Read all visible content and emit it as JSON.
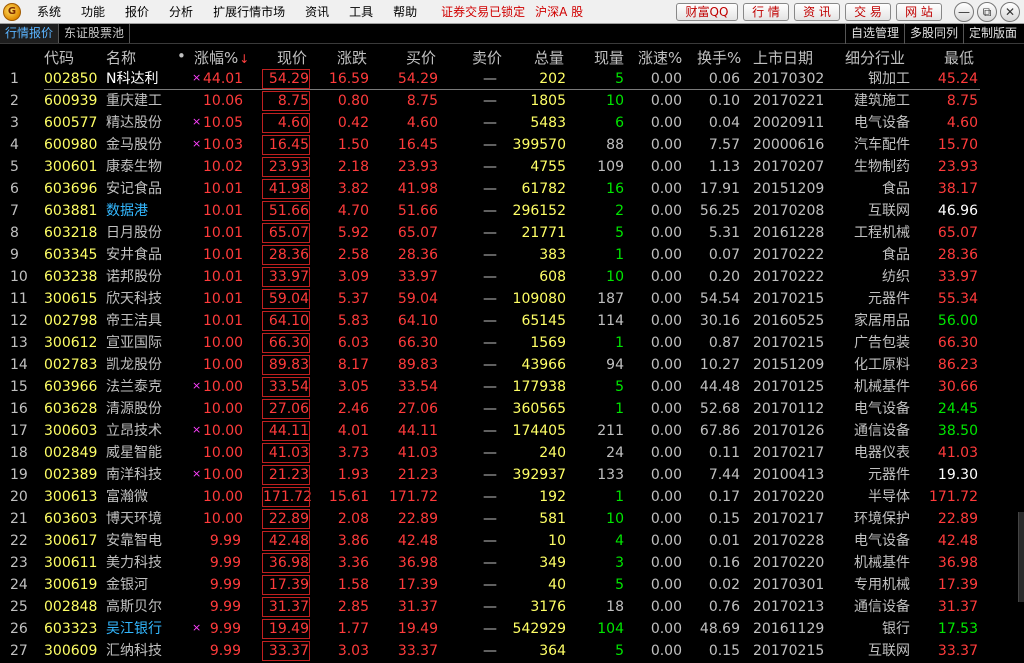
{
  "menu": {
    "items": [
      "系统",
      "功能",
      "报价",
      "分析",
      "扩展行情市场",
      "资讯",
      "工具",
      "帮助"
    ],
    "status": "证券交易已锁定",
    "market": "沪深A 股"
  },
  "top_buttons": [
    "财富QQ",
    "行 情",
    "资 讯",
    "交 易",
    "网 站"
  ],
  "window_controls": [
    "—",
    "⧉",
    "✕"
  ],
  "tabs": {
    "active": "行情报价",
    "other": "东证股票池"
  },
  "right_tabs": [
    "自选管理",
    "多股同列",
    "定制版面"
  ],
  "columns": {
    "code": "代码",
    "name": "名称",
    "dot": "•",
    "pct": "涨幅%",
    "sort": "↓",
    "price": "现价",
    "chg": "涨跌",
    "bid": "买价",
    "ask": "卖价",
    "vol": "总量",
    "cur": "现量",
    "speed": "涨速%",
    "turn": "换手%",
    "date": "上市日期",
    "ind": "细分行业",
    "low": "最低"
  },
  "rows": [
    {
      "idx": "1",
      "code": "002850",
      "name": "N科达利",
      "mark": "×",
      "pct": "44.01",
      "price": "54.29",
      "chg": "16.59",
      "bid": "54.29",
      "ask": "—",
      "vol": "202",
      "cur": "5",
      "speed": "0.00",
      "turn": "0.06",
      "date": "20170302",
      "ind": "钢加工",
      "low": "45.24",
      "name_style": "bold",
      "cur_style": "green",
      "low_style": "red"
    },
    {
      "idx": "2",
      "code": "600939",
      "name": "重庆建工",
      "mark": "",
      "pct": "10.06",
      "price": "8.75",
      "chg": "0.80",
      "bid": "8.75",
      "ask": "—",
      "vol": "1805",
      "cur": "10",
      "speed": "0.00",
      "turn": "0.10",
      "date": "20170221",
      "ind": "建筑施工",
      "low": "8.75",
      "name_style": "",
      "cur_style": "green",
      "low_style": "red"
    },
    {
      "idx": "3",
      "code": "600577",
      "name": "精达股份",
      "mark": "×",
      "pct": "10.05",
      "price": "4.60",
      "chg": "0.42",
      "bid": "4.60",
      "ask": "—",
      "vol": "5483",
      "cur": "6",
      "speed": "0.00",
      "turn": "0.04",
      "date": "20020911",
      "ind": "电气设备",
      "low": "4.60",
      "name_style": "",
      "cur_style": "green",
      "low_style": "red"
    },
    {
      "idx": "4",
      "code": "600980",
      "name": "金马股份",
      "mark": "×",
      "pct": "10.03",
      "price": "16.45",
      "chg": "1.50",
      "bid": "16.45",
      "ask": "—",
      "vol": "399570",
      "cur": "88",
      "speed": "0.00",
      "turn": "7.57",
      "date": "20000616",
      "ind": "汽车配件",
      "low": "15.70",
      "name_style": "",
      "cur_style": "",
      "low_style": "red"
    },
    {
      "idx": "5",
      "code": "300601",
      "name": "康泰生物",
      "mark": "",
      "pct": "10.02",
      "price": "23.93",
      "chg": "2.18",
      "bid": "23.93",
      "ask": "—",
      "vol": "4755",
      "cur": "109",
      "speed": "0.00",
      "turn": "1.13",
      "date": "20170207",
      "ind": "生物制药",
      "low": "23.93",
      "name_style": "",
      "cur_style": "",
      "low_style": "red"
    },
    {
      "idx": "6",
      "code": "603696",
      "name": "安记食品",
      "mark": "",
      "pct": "10.01",
      "price": "41.98",
      "chg": "3.82",
      "bid": "41.98",
      "ask": "—",
      "vol": "61782",
      "cur": "16",
      "speed": "0.00",
      "turn": "17.91",
      "date": "20151209",
      "ind": "食品",
      "low": "38.17",
      "name_style": "",
      "cur_style": "green",
      "low_style": "red"
    },
    {
      "idx": "7",
      "code": "603881",
      "name": "数据港",
      "mark": "",
      "pct": "10.01",
      "price": "51.66",
      "chg": "4.70",
      "bid": "51.66",
      "ask": "—",
      "vol": "296152",
      "cur": "2",
      "speed": "0.00",
      "turn": "56.25",
      "date": "20170208",
      "ind": "互联网",
      "low": "46.96",
      "name_style": "hl",
      "cur_style": "green",
      "low_style": "white"
    },
    {
      "idx": "8",
      "code": "603218",
      "name": "日月股份",
      "mark": "",
      "pct": "10.01",
      "price": "65.07",
      "chg": "5.92",
      "bid": "65.07",
      "ask": "—",
      "vol": "21771",
      "cur": "5",
      "speed": "0.00",
      "turn": "5.31",
      "date": "20161228",
      "ind": "工程机械",
      "low": "65.07",
      "name_style": "",
      "cur_style": "green",
      "low_style": "red"
    },
    {
      "idx": "9",
      "code": "603345",
      "name": "安井食品",
      "mark": "",
      "pct": "10.01",
      "price": "28.36",
      "chg": "2.58",
      "bid": "28.36",
      "ask": "—",
      "vol": "383",
      "cur": "1",
      "speed": "0.00",
      "turn": "0.07",
      "date": "20170222",
      "ind": "食品",
      "low": "28.36",
      "name_style": "",
      "cur_style": "green",
      "low_style": "red"
    },
    {
      "idx": "10",
      "code": "603238",
      "name": "诺邦股份",
      "mark": "",
      "pct": "10.01",
      "price": "33.97",
      "chg": "3.09",
      "bid": "33.97",
      "ask": "—",
      "vol": "608",
      "cur": "10",
      "speed": "0.00",
      "turn": "0.20",
      "date": "20170222",
      "ind": "纺织",
      "low": "33.97",
      "name_style": "",
      "cur_style": "green",
      "low_style": "red"
    },
    {
      "idx": "11",
      "code": "300615",
      "name": "欣天科技",
      "mark": "",
      "pct": "10.01",
      "price": "59.04",
      "chg": "5.37",
      "bid": "59.04",
      "ask": "—",
      "vol": "109080",
      "cur": "187",
      "speed": "0.00",
      "turn": "54.54",
      "date": "20170215",
      "ind": "元器件",
      "low": "55.34",
      "name_style": "",
      "cur_style": "",
      "low_style": "red"
    },
    {
      "idx": "12",
      "code": "002798",
      "name": "帝王洁具",
      "mark": "",
      "pct": "10.01",
      "price": "64.10",
      "chg": "5.83",
      "bid": "64.10",
      "ask": "—",
      "vol": "65145",
      "cur": "114",
      "speed": "0.00",
      "turn": "30.16",
      "date": "20160525",
      "ind": "家居用品",
      "low": "56.00",
      "name_style": "",
      "cur_style": "",
      "low_style": "green"
    },
    {
      "idx": "13",
      "code": "300612",
      "name": "宣亚国际",
      "mark": "",
      "pct": "10.00",
      "price": "66.30",
      "chg": "6.03",
      "bid": "66.30",
      "ask": "—",
      "vol": "1569",
      "cur": "1",
      "speed": "0.00",
      "turn": "0.87",
      "date": "20170215",
      "ind": "广告包装",
      "low": "66.30",
      "name_style": "",
      "cur_style": "green",
      "low_style": "red"
    },
    {
      "idx": "14",
      "code": "002783",
      "name": "凯龙股份",
      "mark": "",
      "pct": "10.00",
      "price": "89.83",
      "chg": "8.17",
      "bid": "89.83",
      "ask": "—",
      "vol": "43966",
      "cur": "94",
      "speed": "0.00",
      "turn": "10.27",
      "date": "20151209",
      "ind": "化工原料",
      "low": "86.23",
      "name_style": "",
      "cur_style": "",
      "low_style": "red"
    },
    {
      "idx": "15",
      "code": "603966",
      "name": "法兰泰克",
      "mark": "×",
      "pct": "10.00",
      "price": "33.54",
      "chg": "3.05",
      "bid": "33.54",
      "ask": "—",
      "vol": "177938",
      "cur": "5",
      "speed": "0.00",
      "turn": "44.48",
      "date": "20170125",
      "ind": "机械基件",
      "low": "30.66",
      "name_style": "",
      "cur_style": "green",
      "low_style": "red"
    },
    {
      "idx": "16",
      "code": "603628",
      "name": "清源股份",
      "mark": "",
      "pct": "10.00",
      "price": "27.06",
      "chg": "2.46",
      "bid": "27.06",
      "ask": "—",
      "vol": "360565",
      "cur": "1",
      "speed": "0.00",
      "turn": "52.68",
      "date": "20170112",
      "ind": "电气设备",
      "low": "24.45",
      "name_style": "",
      "cur_style": "green",
      "low_style": "green"
    },
    {
      "idx": "17",
      "code": "300603",
      "name": "立昂技术",
      "mark": "×",
      "pct": "10.00",
      "price": "44.11",
      "chg": "4.01",
      "bid": "44.11",
      "ask": "—",
      "vol": "174405",
      "cur": "211",
      "speed": "0.00",
      "turn": "67.86",
      "date": "20170126",
      "ind": "通信设备",
      "low": "38.50",
      "name_style": "",
      "cur_style": "",
      "low_style": "green"
    },
    {
      "idx": "18",
      "code": "002849",
      "name": "威星智能",
      "mark": "",
      "pct": "10.00",
      "price": "41.03",
      "chg": "3.73",
      "bid": "41.03",
      "ask": "—",
      "vol": "240",
      "cur": "24",
      "speed": "0.00",
      "turn": "0.11",
      "date": "20170217",
      "ind": "电器仪表",
      "low": "41.03",
      "name_style": "",
      "cur_style": "",
      "low_style": "red"
    },
    {
      "idx": "19",
      "code": "002389",
      "name": "南洋科技",
      "mark": "×",
      "pct": "10.00",
      "price": "21.23",
      "chg": "1.93",
      "bid": "21.23",
      "ask": "—",
      "vol": "392937",
      "cur": "133",
      "speed": "0.00",
      "turn": "7.44",
      "date": "20100413",
      "ind": "元器件",
      "low": "19.30",
      "name_style": "",
      "cur_style": "",
      "low_style": "white"
    },
    {
      "idx": "20",
      "code": "300613",
      "name": "富瀚微",
      "mark": "",
      "pct": "10.00",
      "price": "171.72",
      "chg": "15.61",
      "bid": "171.72",
      "ask": "—",
      "vol": "192",
      "cur": "1",
      "speed": "0.00",
      "turn": "0.17",
      "date": "20170220",
      "ind": "半导体",
      "low": "171.72",
      "name_style": "",
      "cur_style": "green",
      "low_style": "red"
    },
    {
      "idx": "21",
      "code": "603603",
      "name": "博天环境",
      "mark": "",
      "pct": "10.00",
      "price": "22.89",
      "chg": "2.08",
      "bid": "22.89",
      "ask": "—",
      "vol": "581",
      "cur": "10",
      "speed": "0.00",
      "turn": "0.15",
      "date": "20170217",
      "ind": "环境保护",
      "low": "22.89",
      "name_style": "",
      "cur_style": "green",
      "low_style": "red"
    },
    {
      "idx": "22",
      "code": "300617",
      "name": "安靠智电",
      "mark": "",
      "pct": "9.99",
      "price": "42.48",
      "chg": "3.86",
      "bid": "42.48",
      "ask": "—",
      "vol": "10",
      "cur": "4",
      "speed": "0.00",
      "turn": "0.01",
      "date": "20170228",
      "ind": "电气设备",
      "low": "42.48",
      "name_style": "",
      "cur_style": "green",
      "low_style": "red"
    },
    {
      "idx": "23",
      "code": "300611",
      "name": "美力科技",
      "mark": "",
      "pct": "9.99",
      "price": "36.98",
      "chg": "3.36",
      "bid": "36.98",
      "ask": "—",
      "vol": "349",
      "cur": "3",
      "speed": "0.00",
      "turn": "0.16",
      "date": "20170220",
      "ind": "机械基件",
      "low": "36.98",
      "name_style": "",
      "cur_style": "green",
      "low_style": "red"
    },
    {
      "idx": "24",
      "code": "300619",
      "name": "金银河",
      "mark": "",
      "pct": "9.99",
      "price": "17.39",
      "chg": "1.58",
      "bid": "17.39",
      "ask": "—",
      "vol": "40",
      "cur": "5",
      "speed": "0.00",
      "turn": "0.02",
      "date": "20170301",
      "ind": "专用机械",
      "low": "17.39",
      "name_style": "",
      "cur_style": "green",
      "low_style": "red"
    },
    {
      "idx": "25",
      "code": "002848",
      "name": "高斯贝尔",
      "mark": "",
      "pct": "9.99",
      "price": "31.37",
      "chg": "2.85",
      "bid": "31.37",
      "ask": "—",
      "vol": "3176",
      "cur": "18",
      "speed": "0.00",
      "turn": "0.76",
      "date": "20170213",
      "ind": "通信设备",
      "low": "31.37",
      "name_style": "",
      "cur_style": "",
      "low_style": "red"
    },
    {
      "idx": "26",
      "code": "603323",
      "name": "吴江银行",
      "mark": "×",
      "pct": "9.99",
      "price": "19.49",
      "chg": "1.77",
      "bid": "19.49",
      "ask": "—",
      "vol": "542929",
      "cur": "104",
      "speed": "0.00",
      "turn": "48.69",
      "date": "20161129",
      "ind": "银行",
      "low": "17.53",
      "name_style": "hl",
      "cur_style": "green",
      "low_style": "green"
    },
    {
      "idx": "27",
      "code": "300609",
      "name": "汇纳科技",
      "mark": "",
      "pct": "9.99",
      "price": "33.37",
      "chg": "3.03",
      "bid": "33.37",
      "ask": "—",
      "vol": "364",
      "cur": "5",
      "speed": "0.00",
      "turn": "0.15",
      "date": "20170215",
      "ind": "互联网",
      "low": "33.37",
      "name_style": "",
      "cur_style": "green",
      "low_style": "red"
    }
  ]
}
